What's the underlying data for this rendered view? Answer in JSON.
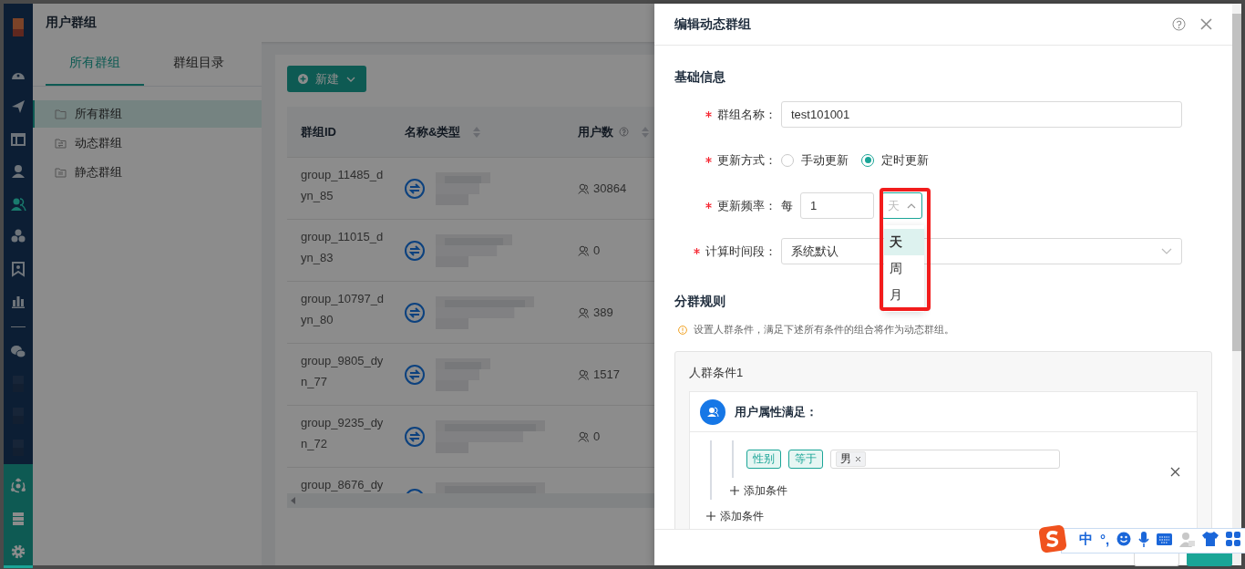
{
  "nav": {
    "items": [
      {
        "kind": "logo"
      },
      {
        "kind": "gauge",
        "selected": false
      },
      {
        "kind": "send",
        "selected": false
      },
      {
        "kind": "layout",
        "selected": false
      },
      {
        "kind": "user",
        "selected": false
      },
      {
        "kind": "users",
        "selected": true
      },
      {
        "kind": "cluster",
        "selected": false
      },
      {
        "kind": "bookmark",
        "selected": false
      },
      {
        "kind": "chart",
        "selected": false
      },
      {
        "kind": "divider"
      },
      {
        "kind": "chat",
        "selected": false
      },
      {
        "kind": "blurred"
      },
      {
        "kind": "blurred"
      },
      {
        "kind": "blurred"
      }
    ],
    "tools": [
      {
        "kind": "orbit"
      },
      {
        "kind": "server"
      },
      {
        "kind": "gear"
      }
    ]
  },
  "header": {
    "title": "用户群组"
  },
  "panel": {
    "tabs": [
      {
        "label": "所有群组",
        "selected": true
      },
      {
        "label": "群组目录",
        "selected": false
      }
    ],
    "tree": [
      {
        "label": "所有群组",
        "kind": "folder",
        "selected": true
      },
      {
        "label": "动态群组",
        "kind": "dynamic",
        "selected": false
      },
      {
        "label": "静态群组",
        "kind": "static",
        "selected": false
      }
    ]
  },
  "toolbar": {
    "new_button": "新建"
  },
  "table": {
    "columns": [
      {
        "label": "群组ID",
        "sortable": false,
        "help": false
      },
      {
        "label": "名称&类型",
        "sortable": true,
        "help": false
      },
      {
        "label": "用户数",
        "sortable": true,
        "help": true
      }
    ],
    "rows": [
      {
        "id": "group_11485_dyn_85",
        "count": "30864"
      },
      {
        "id": "group_11015_dyn_83",
        "count": "0"
      },
      {
        "id": "group_10797_dyn_80",
        "count": "389"
      },
      {
        "id": "group_9805_dyn_77",
        "count": "1517"
      },
      {
        "id": "group_9235_dyn_72",
        "count": "0"
      },
      {
        "id": "group_8676_dy"
      }
    ]
  },
  "drawer": {
    "title": "编辑动态群组",
    "basic_title": "基础信息",
    "name_field": {
      "label": "群组名称：",
      "required": true,
      "value": "test101001"
    },
    "update_mode": {
      "label": "更新方式：",
      "required": true,
      "options": [
        {
          "label": "手动更新",
          "selected": false
        },
        {
          "label": "定时更新",
          "selected": true
        }
      ]
    },
    "frequency": {
      "label": "更新频率：",
      "required": true,
      "prefix": "每",
      "value": "1",
      "unit": {
        "value": "天",
        "open": true,
        "options": [
          {
            "label": "天",
            "selected": true
          },
          {
            "label": "周",
            "selected": false
          },
          {
            "label": "月",
            "selected": false
          }
        ]
      }
    },
    "period": {
      "label": "计算时间段：",
      "required": true,
      "value": "系统默认"
    },
    "rules_title": "分群规则",
    "hint": "设置人群条件，满足下述所有条件的组合将作为动态群组。",
    "condition": {
      "title": "人群条件1",
      "group_title": "用户属性满足：",
      "rule": {
        "field": "性别",
        "operator": "等于",
        "values": [
          "男"
        ]
      },
      "add_inner": "添加条件",
      "add_outer": "添加条件"
    },
    "footer": {
      "buttons": [
        {
          "kind": "default"
        },
        {
          "kind": "primary"
        }
      ]
    }
  },
  "ime": {
    "items": [
      "中",
      "°,"
    ]
  }
}
